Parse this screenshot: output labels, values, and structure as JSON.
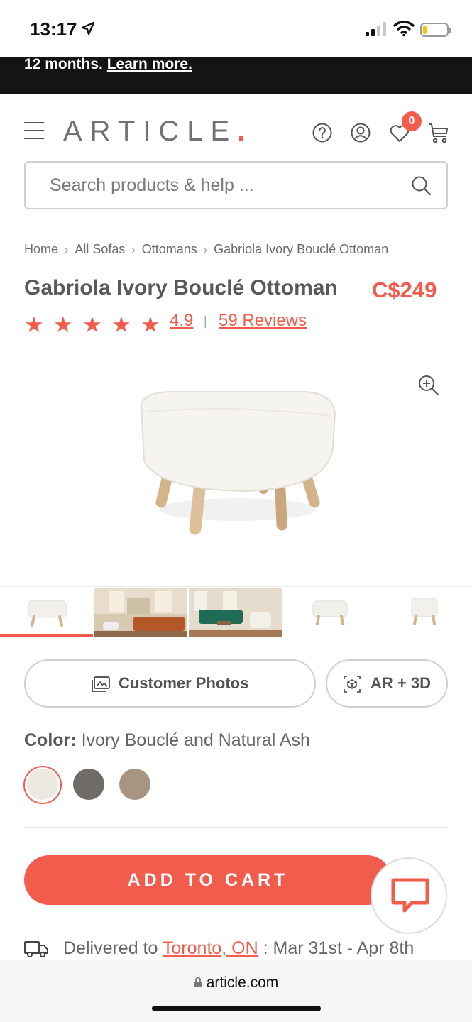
{
  "status_bar": {
    "time": "13:17"
  },
  "promo": {
    "text": "12 months.",
    "link": "Learn more."
  },
  "header": {
    "logo": "ARTICLE",
    "logo_dot": ".",
    "wishlist_count": "0"
  },
  "search": {
    "placeholder": "Search products & help ..."
  },
  "breadcrumb": {
    "items": [
      "Home",
      "All Sofas",
      "Ottomans",
      "Gabriola Ivory Bouclé Ottoman"
    ]
  },
  "product": {
    "title": "Gabriola Ivory Bouclé Ottoman",
    "price": "C$249",
    "rating": "4.9",
    "rating_value": 4.9,
    "rating_max": 5,
    "reviews": "59 Reviews"
  },
  "buttons": {
    "customer_photos": "Customer Photos",
    "ar3d": "AR + 3D",
    "add_to_cart": "ADD TO CART"
  },
  "color": {
    "label": "Color:",
    "value": "Ivory Bouclé and Natural Ash",
    "swatches": [
      "#ece9e3",
      "#6f6b67",
      "#a89482"
    ]
  },
  "delivery": {
    "prefix": "Delivered to",
    "location": "Toronto, ON",
    "dates": ": Mar 31st - Apr 8th"
  },
  "url_bar": {
    "url": "article.com"
  },
  "colors": {
    "accent": "#f25c4c",
    "text": "#595959",
    "banner": "#141414"
  }
}
